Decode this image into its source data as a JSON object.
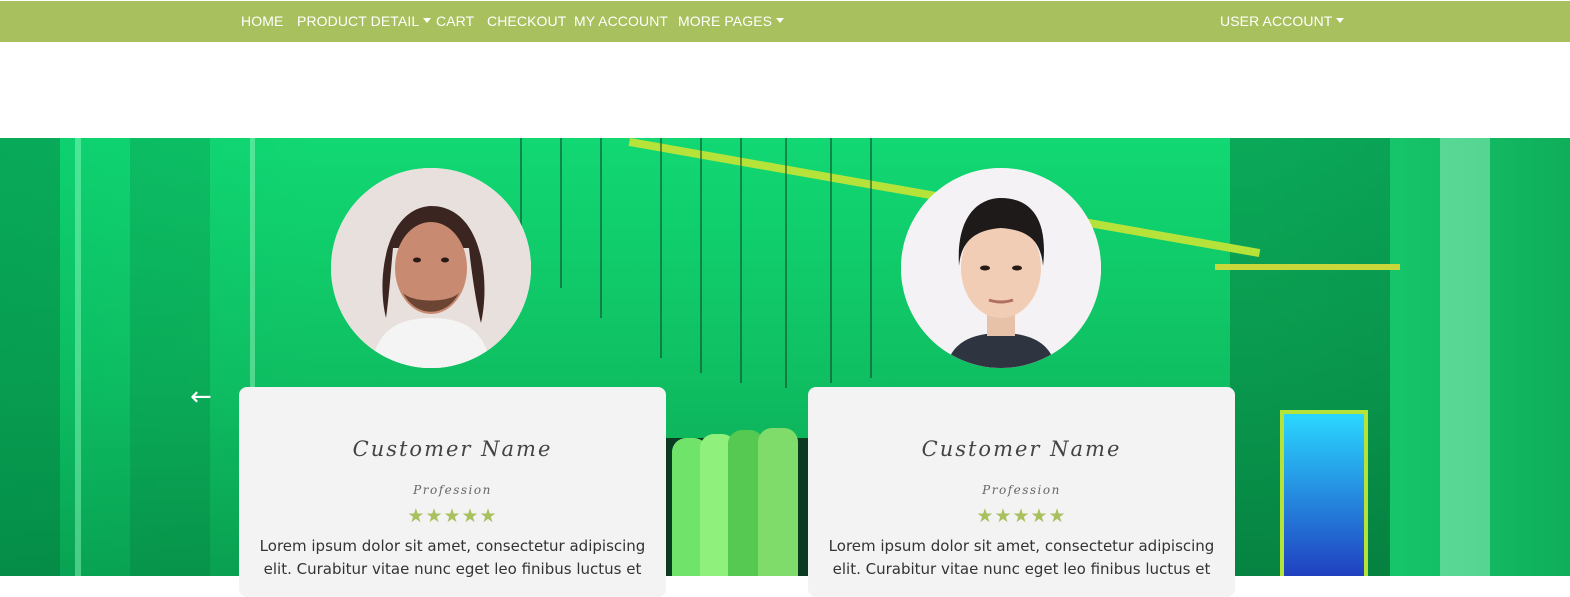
{
  "nav": {
    "home": "HOME",
    "product_detail": "PRODUCT DETAIL",
    "cart": "CART",
    "checkout": "CHECKOUT",
    "my_account": "MY ACCOUNT",
    "more_pages": "MORE PAGES",
    "user_account": "USER ACCOUNT"
  },
  "testimonials": [
    {
      "name": "Customer Name",
      "profession": "Profession",
      "stars": "★★★★★",
      "text": "Lorem ipsum dolor sit amet, consectetur adipiscing elit. Curabitur vitae nunc eget leo finibus luctus et"
    },
    {
      "name": "Customer Name",
      "profession": "Profession",
      "stars": "★★★★★",
      "text": "Lorem ipsum dolor sit amet, consectetur adipiscing elit. Curabitur vitae nunc eget leo finibus luctus et"
    }
  ],
  "carousel": {
    "prev_arrow": "←"
  },
  "colors": {
    "navbar": "#a8c15e",
    "accent": "#a8c15e",
    "hero": "#11d873",
    "card": "#f3f3f3"
  },
  "icons": {
    "rating": "star-icon",
    "carousel_prev": "arrow-left-icon",
    "dropdown": "caret-down-icon"
  }
}
